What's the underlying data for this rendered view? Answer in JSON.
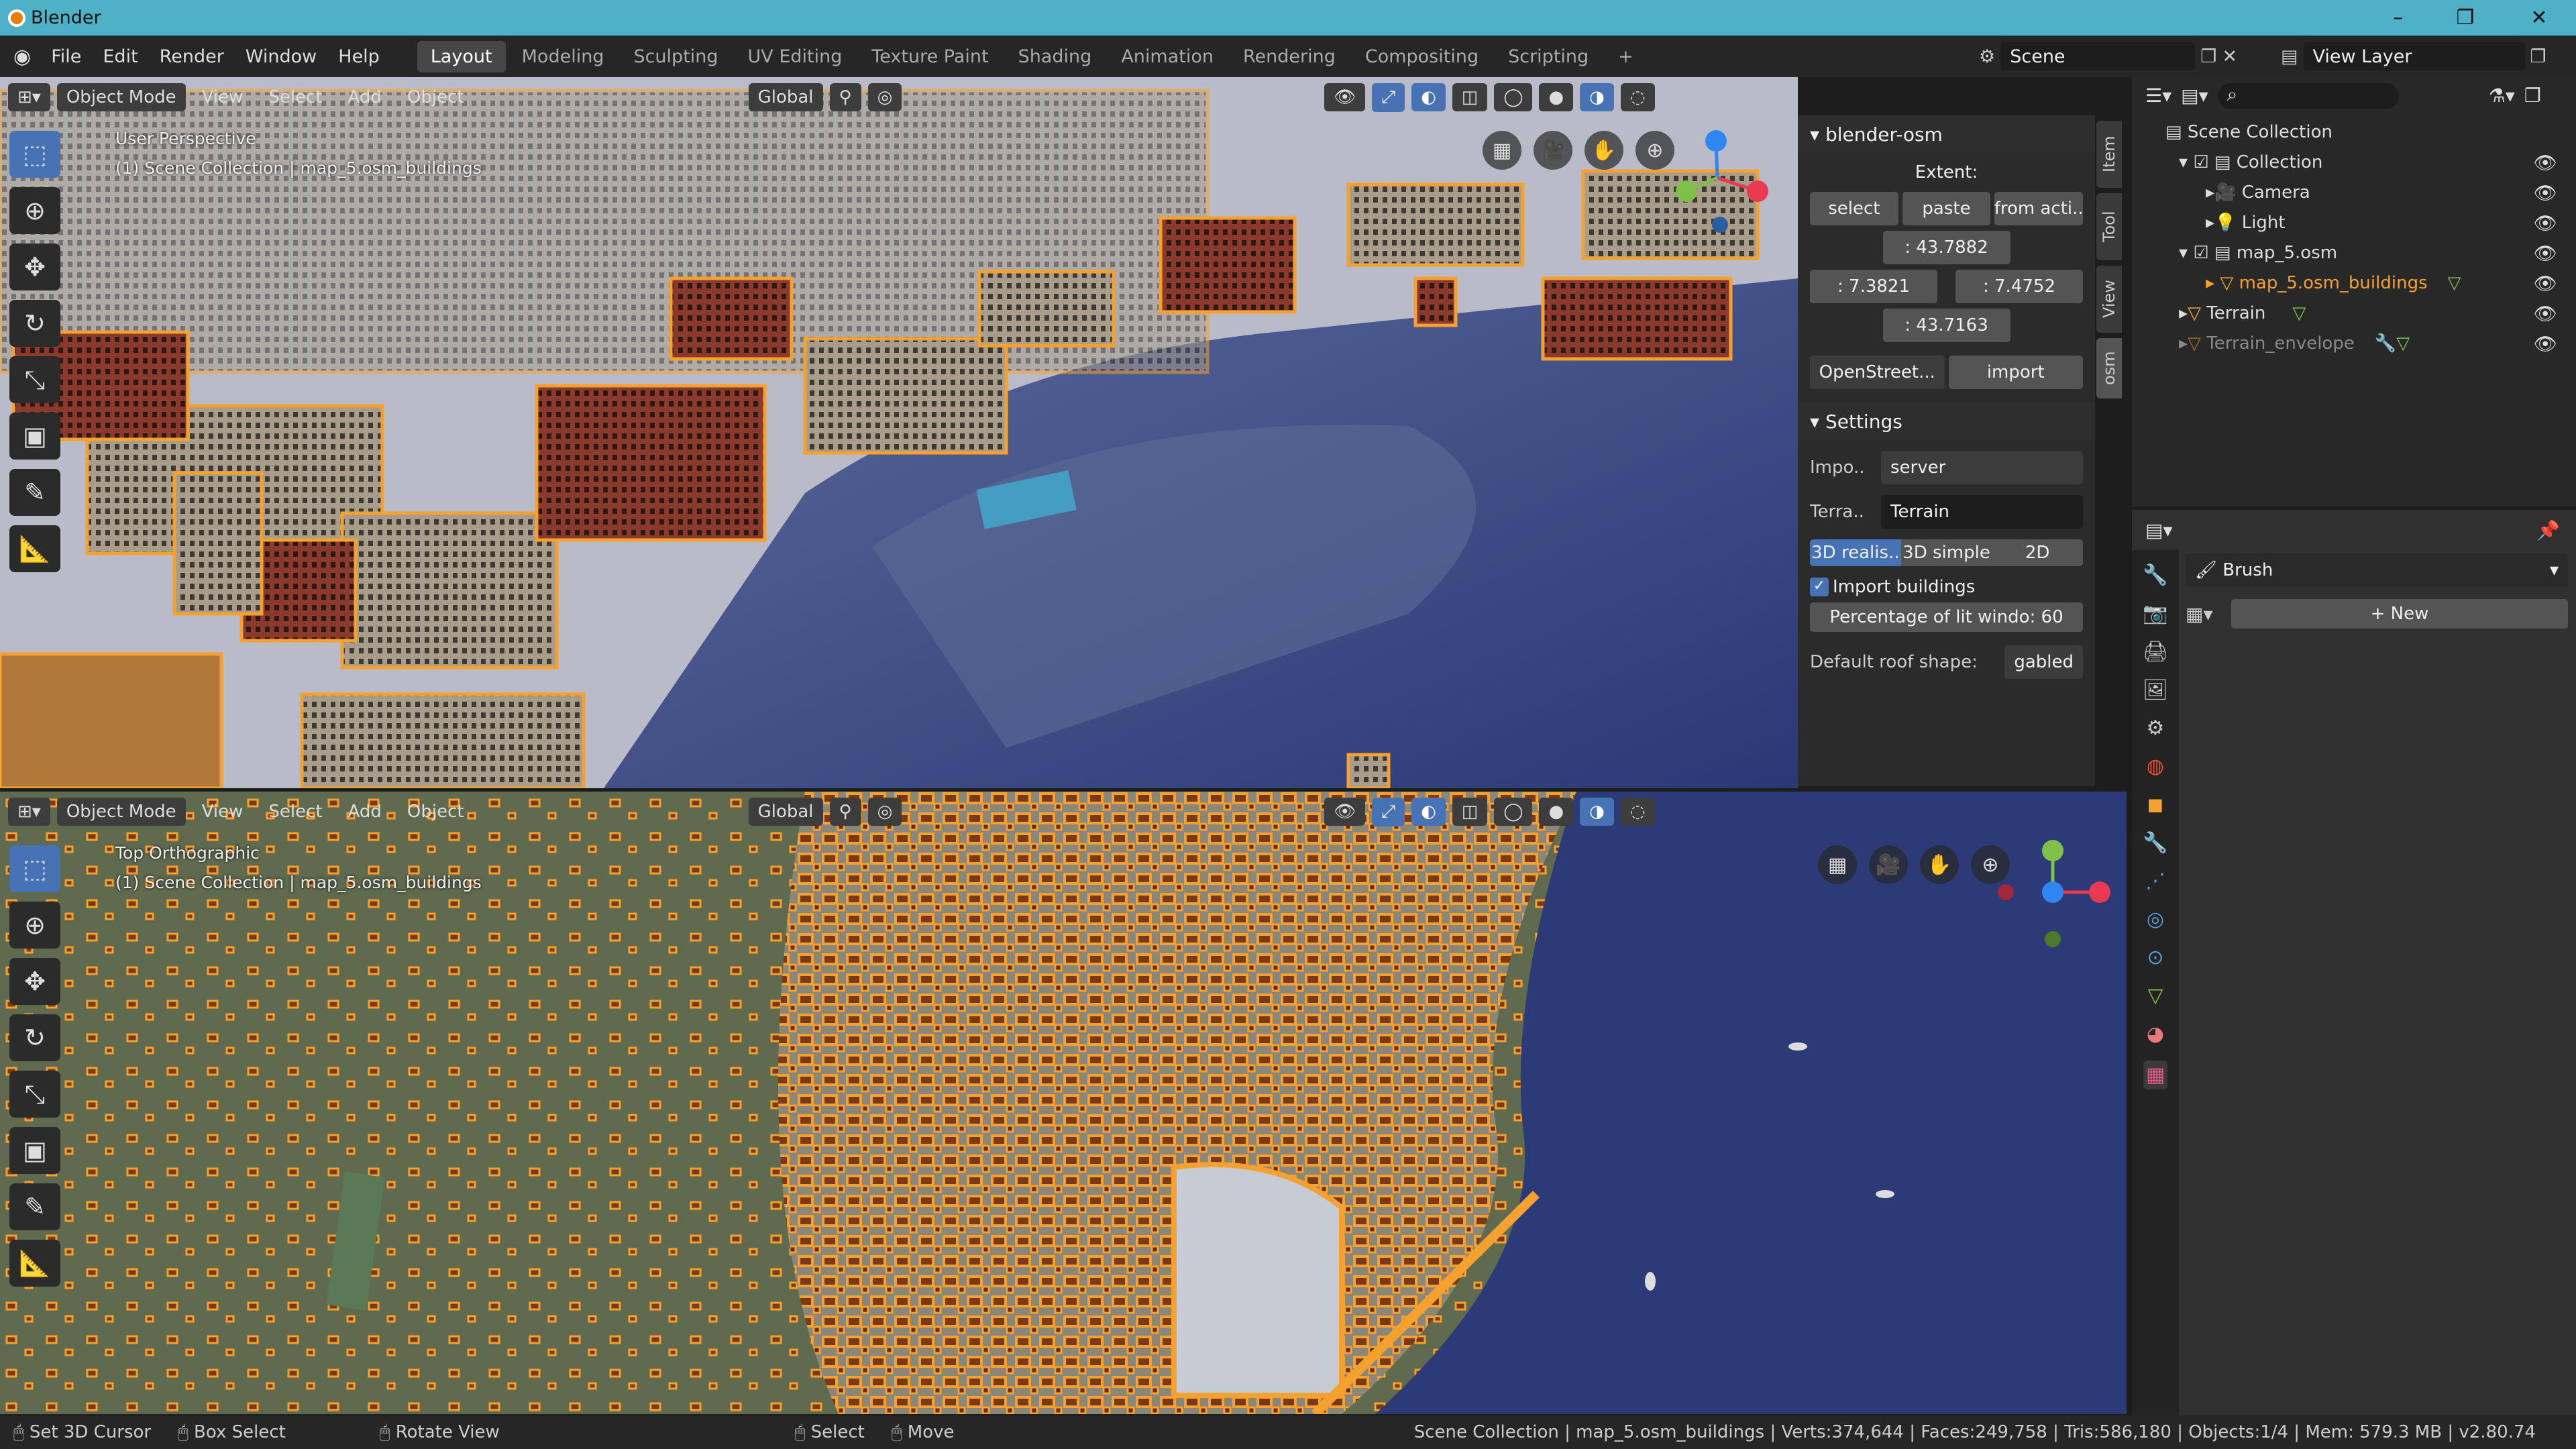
{
  "window": {
    "title": "Blender"
  },
  "menu": [
    "File",
    "Edit",
    "Render",
    "Window",
    "Help"
  ],
  "workspaces": [
    "Layout",
    "Modeling",
    "Sculpting",
    "UV Editing",
    "Texture Paint",
    "Shading",
    "Animation",
    "Rendering",
    "Compositing",
    "Scripting"
  ],
  "active_workspace": "Layout",
  "scene_name": "Scene",
  "view_layer": "View Layer",
  "viewport_top": {
    "mode": "Object Mode",
    "menus": [
      "View",
      "Select",
      "Add",
      "Object"
    ],
    "transform": "Global",
    "view_name": "User Perspective",
    "collection_info": "(1) Scene Collection | map_5.osm_buildings"
  },
  "viewport_bottom": {
    "mode": "Object Mode",
    "menus": [
      "View",
      "Select",
      "Add",
      "Object"
    ],
    "transform": "Global",
    "view_name": "Top Orthographic",
    "collection_info": "(1) Scene Collection | map_5.osm_buildings"
  },
  "osm_panel": {
    "title": "blender-osm",
    "extent_label": "Extent:",
    "buttons": [
      "select",
      "paste",
      "from acti.."
    ],
    "north": ": 43.7882",
    "west": ": 7.3821",
    "east": ": 7.4752",
    "south": ": 43.7163",
    "source": "OpenStreet...",
    "import_label": "import",
    "settings_title": "Settings",
    "import_from_label": "Impo..",
    "import_from_value": "server",
    "terrain_label": "Terra..",
    "terrain_value": "Terrain",
    "modes": [
      "3D realis..",
      "3D simple",
      "2D"
    ],
    "import_buildings": "Import buildings",
    "lit_windows": "Percentage of lit windo:  60",
    "roof_label": "Default roof shape:",
    "roof_value": "gabled"
  },
  "sidebar_tabs": [
    "Item",
    "Tool",
    "View",
    "osm"
  ],
  "outliner": {
    "root": "Scene Collection",
    "items": [
      {
        "label": "Collection",
        "indent": 1
      },
      {
        "label": "Camera",
        "indent": 2
      },
      {
        "label": "Light",
        "indent": 2
      },
      {
        "label": "map_5.osm",
        "indent": 1
      },
      {
        "label": "map_5.osm_buildings",
        "indent": 2
      },
      {
        "label": "Terrain",
        "indent": 1
      },
      {
        "label": "Terrain_envelope",
        "indent": 1
      }
    ]
  },
  "properties": {
    "brush_label": "Brush",
    "new_label": "New"
  },
  "statusbar": {
    "items": [
      "Set 3D Cursor",
      "Box Select",
      "Rotate View",
      "Select",
      "Move"
    ],
    "stats": "Scene Collection | map_5.osm_buildings | Verts:374,644 | Faces:249,758 | Tris:586,180 | Objects:1/4 | Mem: 579.3 MB | v2.80.74"
  },
  "colors": {
    "accent": "#4772b3",
    "selection": "#f5a12f",
    "titlebar": "#4fb1c6",
    "sea": "#2c3a78"
  }
}
